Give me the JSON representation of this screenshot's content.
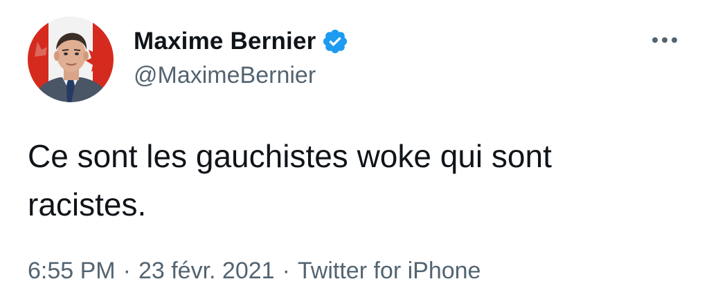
{
  "author": {
    "display_name": "Maxime Bernier",
    "handle": "@MaximeBernier",
    "verified": true
  },
  "icons": {
    "verified": "verified-badge-icon",
    "more": "more-options-icon"
  },
  "tweet": {
    "text": "Ce sont les gauchistes woke qui sont racistes.",
    "time": "6:55 PM",
    "separator": "·",
    "date": "23 févr. 2021",
    "source": "Twitter for iPhone"
  },
  "colors": {
    "verified_blue": "#1d9bf0",
    "text_primary": "#0f1419",
    "text_secondary": "#536471"
  }
}
